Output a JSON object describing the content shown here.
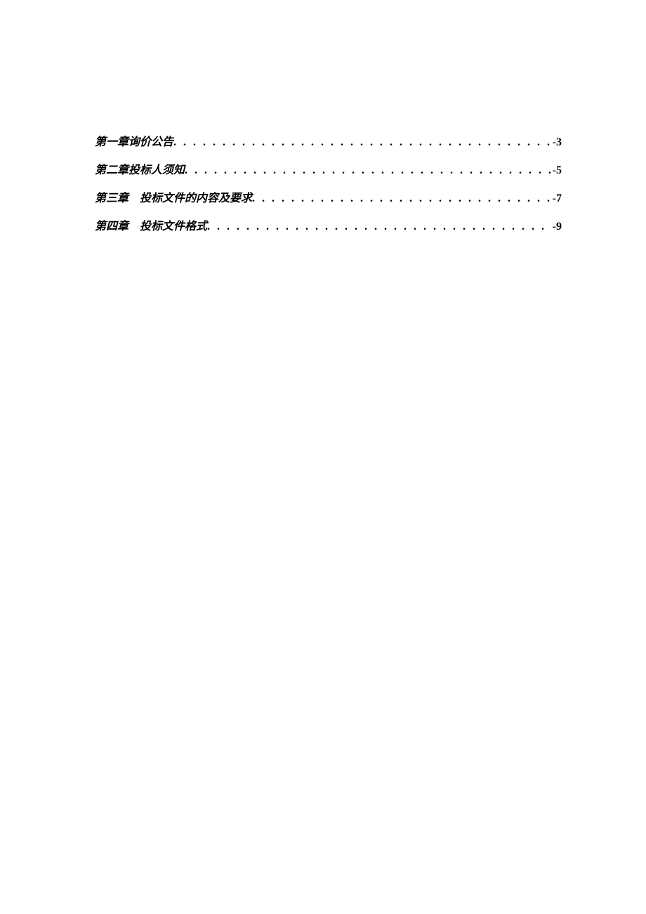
{
  "toc": [
    {
      "title": "第一章询价公告",
      "page": "-3"
    },
    {
      "title": "第二章投标人须知",
      "page": "-5"
    },
    {
      "title": "第三章　投标文件的内容及要求",
      "page": "-7"
    },
    {
      "title": "第四章　投标文件格式",
      "page": "-9"
    }
  ]
}
